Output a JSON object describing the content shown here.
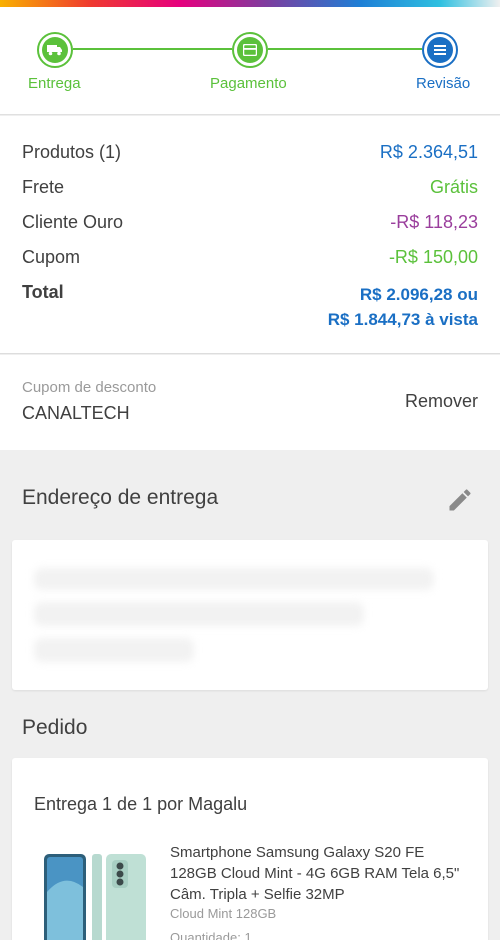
{
  "colors": {
    "accent_blue": "#1a6fc4",
    "success_green": "#5bc13b",
    "discount_purple": "#9a3e9c"
  },
  "checkout_steps": [
    {
      "label": "Entrega",
      "icon": "truck-icon",
      "state": "done"
    },
    {
      "label": "Pagamento",
      "icon": "card-icon",
      "state": "done"
    },
    {
      "label": "Revisão",
      "icon": "list-icon",
      "state": "current"
    }
  ],
  "summary": {
    "products_label": "Produtos (1)",
    "products_value": "R$ 2.364,51",
    "shipping_label": "Frete",
    "shipping_value": "Grátis",
    "gold_label": "Cliente Ouro",
    "gold_value": "-R$ 118,23",
    "coupon_label": "Cupom",
    "coupon_value": "-R$ 150,00",
    "total_label": "Total",
    "total_value": "R$ 2.096,28 ou",
    "total_cash": "R$ 1.844,73 à vista"
  },
  "coupon": {
    "label": "Cupom de desconto",
    "code": "CANALTECH",
    "remove_label": "Remover"
  },
  "address": {
    "title": "Endereço de entrega",
    "edit_icon": "pencil-icon"
  },
  "order": {
    "title": "Pedido",
    "delivery_title": "Entrega 1 de 1 por Magalu",
    "product_name": "Smartphone Samsung Galaxy S20 FE 128GB Cloud Mint - 4G 6GB RAM Tela 6,5\" Câm. Tripla + Selfie 32MP",
    "product_variant": "Cloud Mint 128GB",
    "product_quantity": "Quantidade: 1"
  }
}
